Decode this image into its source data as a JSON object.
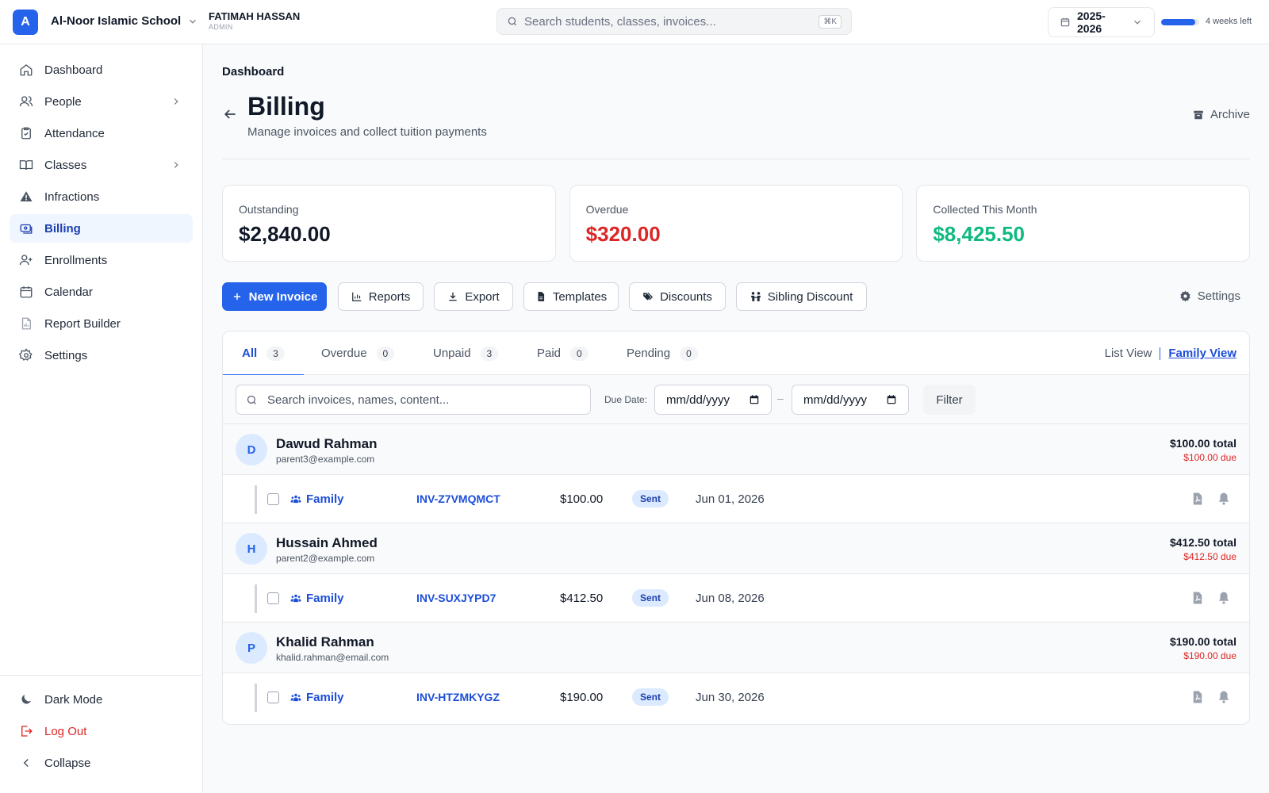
{
  "header": {
    "school_initial": "A",
    "school_name": "Al-Noor Islamic School",
    "user_name": "FATIMAH HASSAN",
    "user_role": "ADMIN",
    "search_placeholder": "Search students, classes, invoices...",
    "search_shortcut": "⌘K",
    "academic_year": "2025-2026",
    "term_progress_percent": 90,
    "term_remaining": "4 weeks left"
  },
  "sidebar": {
    "items": [
      {
        "label": "Dashboard",
        "icon": "home-icon"
      },
      {
        "label": "People",
        "icon": "users-icon",
        "has_children": true
      },
      {
        "label": "Attendance",
        "icon": "clipboard-check-icon"
      },
      {
        "label": "Classes",
        "icon": "book-icon",
        "has_children": true
      },
      {
        "label": "Infractions",
        "icon": "warning-icon"
      },
      {
        "label": "Billing",
        "icon": "billing-icon",
        "active": true
      },
      {
        "label": "Enrollments",
        "icon": "user-plus-icon"
      },
      {
        "label": "Calendar",
        "icon": "calendar-icon"
      },
      {
        "label": "Report Builder",
        "icon": "file-chart-icon"
      },
      {
        "label": "Settings",
        "icon": "gear-icon"
      }
    ],
    "bottom": {
      "dark_mode": "Dark Mode",
      "logout": "Log Out",
      "collapse": "Collapse"
    }
  },
  "page": {
    "breadcrumb": "Dashboard",
    "title": "Billing",
    "subtitle": "Manage invoices and collect tuition payments",
    "archive_label": "Archive"
  },
  "stats": [
    {
      "label": "Outstanding",
      "value": "$2,840.00",
      "color": "#111827"
    },
    {
      "label": "Overdue",
      "value": "$320.00",
      "color": "#dc2626"
    },
    {
      "label": "Collected This Month",
      "value": "$8,425.50",
      "color": "#10b981"
    }
  ],
  "toolbar": {
    "new_invoice": "New Invoice",
    "reports": "Reports",
    "export": "Export",
    "templates": "Templates",
    "discounts": "Discounts",
    "sibling_discount": "Sibling Discount",
    "settings": "Settings"
  },
  "tabs": [
    {
      "label": "All",
      "count": "3",
      "active": true
    },
    {
      "label": "Overdue",
      "count": "0"
    },
    {
      "label": "Unpaid",
      "count": "3"
    },
    {
      "label": "Paid",
      "count": "0"
    },
    {
      "label": "Pending",
      "count": "0"
    }
  ],
  "view_toggle": {
    "list": "List View",
    "family": "Family View"
  },
  "filters": {
    "search_placeholder": "Search invoices, names, content...",
    "due_date_label": "Due Date:",
    "date_from": "mm/dd/yyyy",
    "date_separator": "–",
    "date_to": "mm/dd/yyyy",
    "filter_button": "Filter"
  },
  "families": [
    {
      "initial": "D",
      "name": "Dawud Rahman",
      "email": "parent3@example.com",
      "total": "$100.00 total",
      "due": "$100.00 due",
      "invoice": {
        "type": "Family",
        "number": "INV-Z7VMQMCT",
        "amount": "$100.00",
        "status": "Sent",
        "date": "Jun 01, 2026"
      }
    },
    {
      "initial": "H",
      "name": "Hussain Ahmed",
      "email": "parent2@example.com",
      "total": "$412.50 total",
      "due": "$412.50 due",
      "invoice": {
        "type": "Family",
        "number": "INV-SUXJYPD7",
        "amount": "$412.50",
        "status": "Sent",
        "date": "Jun 08, 2026"
      }
    },
    {
      "initial": "P",
      "name": "Khalid Rahman",
      "email": "khalid.rahman@email.com",
      "total": "$190.00 total",
      "due": "$190.00 due",
      "invoice": {
        "type": "Family",
        "number": "INV-HTZMKYGZ",
        "amount": "$190.00",
        "status": "Sent",
        "date": "Jun 30, 2026"
      }
    }
  ]
}
